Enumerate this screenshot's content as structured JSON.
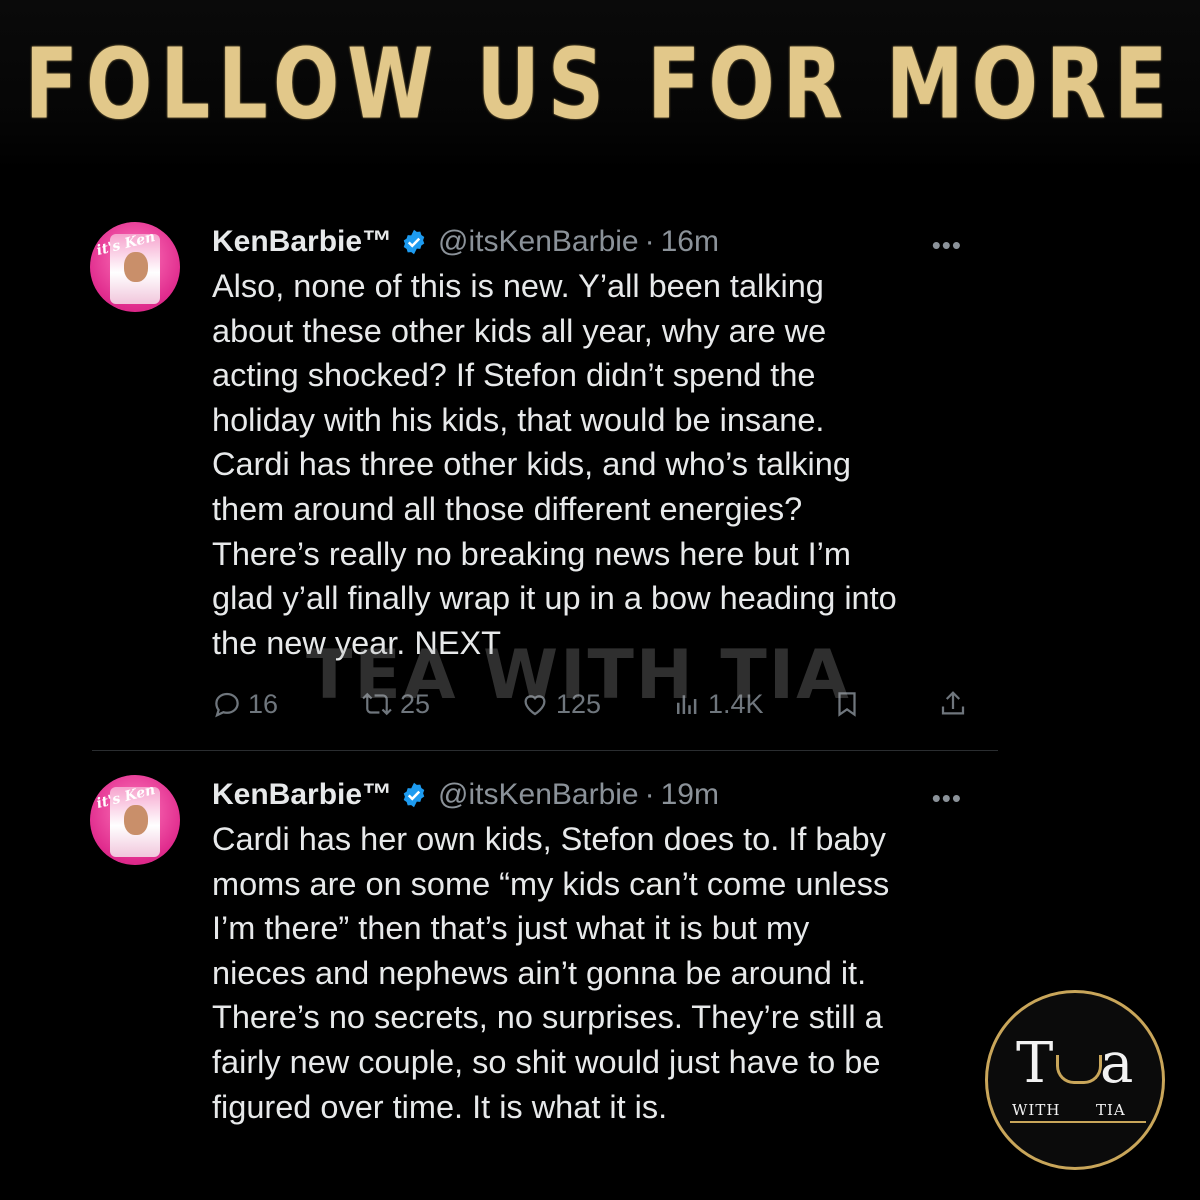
{
  "banner": {
    "text": "FOLLOW US FOR MORE"
  },
  "tweets": [
    {
      "name": "KenBarbie™",
      "handle": "@itsKenBarbie",
      "time": "16m",
      "avatar_text": "it's Ken",
      "text": "Also, none of this is new. Y’all been talking\nabout these other kids all year, why are we\nacting shocked? If Stefon didn’t spend the\nholiday with his kids, that would be insane.\nCardi has three other kids, and who’s talking\nthem around all those different energies?\nThere’s really no breaking news here but I’m\nglad y’all finally wrap it up in a bow heading into\nthe new year. NEXT",
      "replies": "16",
      "reposts": "25",
      "likes": "125",
      "views": "1.4K"
    },
    {
      "name": "KenBarbie™",
      "handle": "@itsKenBarbie",
      "time": "19m",
      "avatar_text": "it's Ken",
      "text": "Cardi has her own kids, Stefon does to. If baby\nmoms are on some “my kids can’t come unless\nI’m there” then that’s just what it is but my\nnieces and nephews ain’t gonna be around it.\nThere’s no secrets, no surprises. They’re still a\nfairly new couple, so shit would just have to be\nfigured over time. It is what it is."
    }
  ],
  "watermark": "TEA WITH TIA",
  "logo": {
    "left": "T",
    "right": "a",
    "with": "WITH",
    "tia": "TIA",
    "accent": "#c9a65a"
  },
  "colors": {
    "verified": "#1d9bf0",
    "muted": "#8b9299",
    "text": "#e7e9ea"
  },
  "icons": [
    "verified-badge-icon",
    "more-icon",
    "reply-icon",
    "repost-icon",
    "like-icon",
    "views-icon",
    "bookmark-icon",
    "share-icon"
  ]
}
